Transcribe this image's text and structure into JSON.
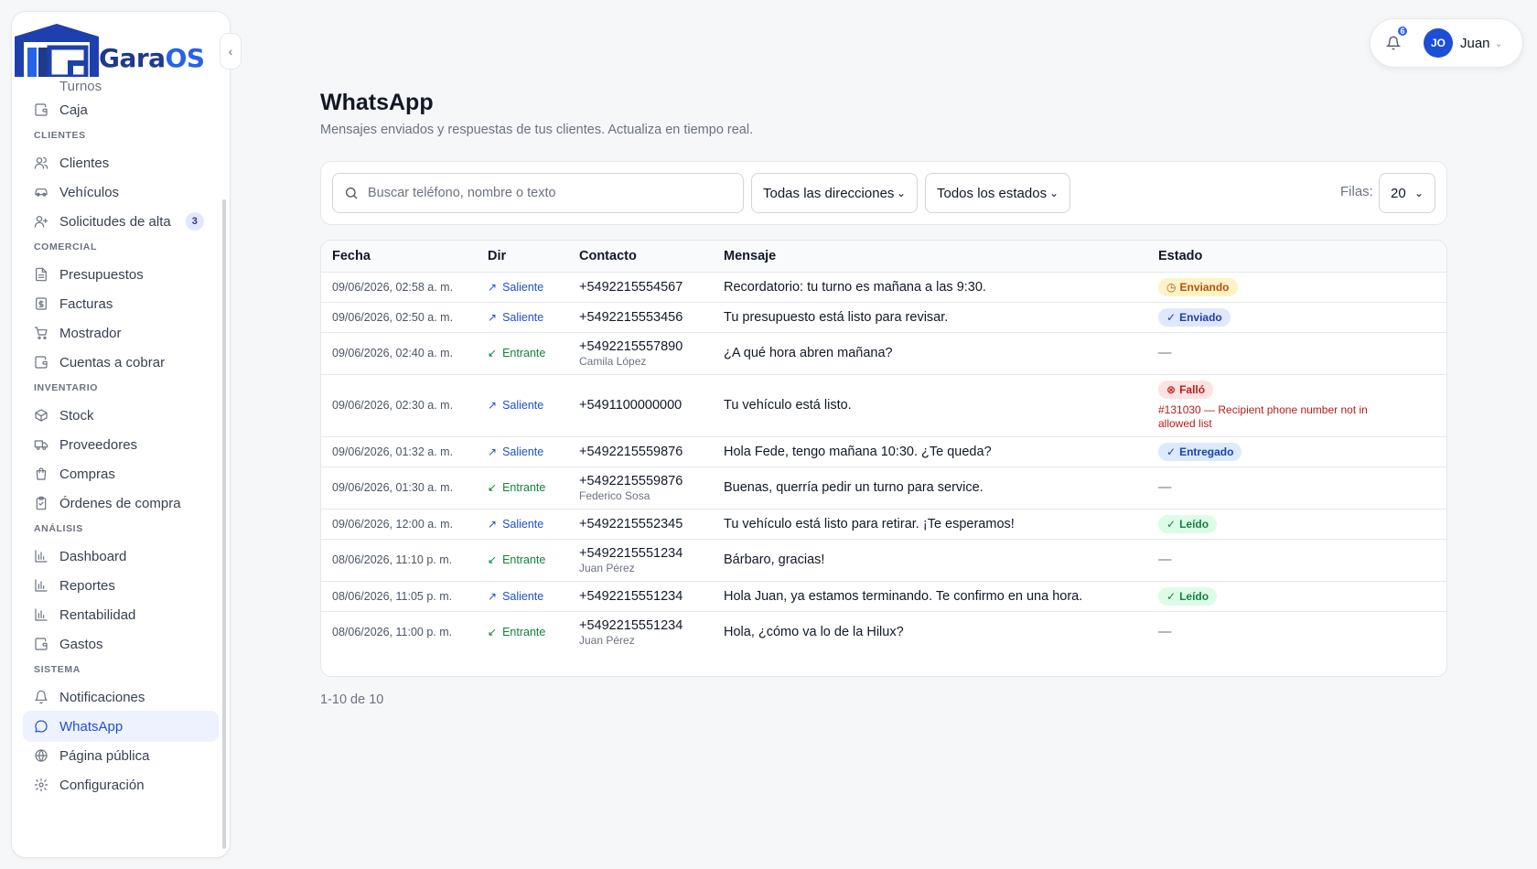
{
  "brand": {
    "name_part1": "Gara",
    "name_part2": "OS"
  },
  "sidebar": {
    "partial_item": "Turnos",
    "groups": [
      {
        "section": "",
        "items": [
          {
            "label": "Caja",
            "icon": "wallet-icon"
          }
        ]
      },
      {
        "section": "CLIENTES",
        "items": [
          {
            "label": "Clientes",
            "icon": "users-icon"
          },
          {
            "label": "Vehículos",
            "icon": "car-icon"
          },
          {
            "label": "Solicitudes de alta",
            "icon": "user-plus-icon",
            "badge": "3"
          }
        ]
      },
      {
        "section": "COMERCIAL",
        "items": [
          {
            "label": "Presupuestos",
            "icon": "file-text-icon"
          },
          {
            "label": "Facturas",
            "icon": "receipt-icon"
          },
          {
            "label": "Mostrador",
            "icon": "cart-icon"
          },
          {
            "label": "Cuentas a cobrar",
            "icon": "wallet-icon"
          }
        ]
      },
      {
        "section": "INVENTARIO",
        "items": [
          {
            "label": "Stock",
            "icon": "box-icon"
          },
          {
            "label": "Proveedores",
            "icon": "truck-icon"
          },
          {
            "label": "Compras",
            "icon": "bag-icon"
          },
          {
            "label": "Órdenes de compra",
            "icon": "clipboard-icon"
          }
        ]
      },
      {
        "section": "ANÁLISIS",
        "items": [
          {
            "label": "Dashboard",
            "icon": "bar-chart-icon"
          },
          {
            "label": "Reportes",
            "icon": "bar-chart-icon"
          },
          {
            "label": "Rentabilidad",
            "icon": "bar-chart-icon"
          },
          {
            "label": "Gastos",
            "icon": "wallet-icon"
          }
        ]
      },
      {
        "section": "SISTEMA",
        "items": [
          {
            "label": "Notificaciones",
            "icon": "bell-icon"
          },
          {
            "label": "WhatsApp",
            "icon": "message-circle-icon",
            "active": true
          },
          {
            "label": "Página pública",
            "icon": "globe-icon"
          },
          {
            "label": "Configuración",
            "icon": "gear-icon"
          }
        ]
      }
    ]
  },
  "header": {
    "notif_count": "6",
    "user_initials": "JO",
    "user_name": "Juan"
  },
  "page": {
    "title": "WhatsApp",
    "subtitle": "Mensajes enviados y respuestas de tus clientes. Actualiza en tiempo real."
  },
  "filters": {
    "search_placeholder": "Buscar teléfono, nombre o texto",
    "direction": "Todas las direcciones",
    "status": "Todos los estados",
    "rows_label": "Filas:",
    "rows_value": "20"
  },
  "table": {
    "headers": {
      "fecha": "Fecha",
      "dir": "Dir",
      "contacto": "Contacto",
      "mensaje": "Mensaje",
      "estado": "Estado"
    },
    "rows": [
      {
        "fecha": "09/06/2026, 02:58 a. m.",
        "dir": "Saliente",
        "dir_type": "out",
        "phone": "+5492215554567",
        "name": "",
        "mensaje": "Recordatorio: tu turno es mañana a las 9:30.",
        "estado": "Enviando",
        "estado_type": "enviando",
        "error": "",
        "height": 33
      },
      {
        "fecha": "09/06/2026, 02:50 a. m.",
        "dir": "Saliente",
        "dir_type": "out",
        "phone": "+5492215553456",
        "name": "",
        "mensaje": "Tu presupuesto está listo para revisar.",
        "estado": "Enviado",
        "estado_type": "enviado",
        "error": "",
        "height": 33
      },
      {
        "fecha": "09/06/2026, 02:40 a. m.",
        "dir": "Entrante",
        "dir_type": "in",
        "phone": "+5492215557890",
        "name": "Camila López",
        "mensaje": "¿A qué hora abren mañana?",
        "estado": "—",
        "estado_type": "none",
        "error": "",
        "height": 46
      },
      {
        "fecha": "09/06/2026, 02:30 a. m.",
        "dir": "Saliente",
        "dir_type": "out",
        "phone": "+5491100000000",
        "name": "",
        "mensaje": "Tu vehículo está listo.",
        "estado": "Falló",
        "estado_type": "fallo",
        "error": "#131030 — Recipient phone number not in allowed list",
        "height": 68
      },
      {
        "fecha": "09/06/2026, 01:32 a. m.",
        "dir": "Saliente",
        "dir_type": "out",
        "phone": "+5492215559876",
        "name": "",
        "mensaje": "Hola Fede, tengo mañana 10:30. ¿Te queda?",
        "estado": "Entregado",
        "estado_type": "entregado",
        "error": "",
        "height": 33
      },
      {
        "fecha": "09/06/2026, 01:30 a. m.",
        "dir": "Entrante",
        "dir_type": "in",
        "phone": "+5492215559876",
        "name": "Federico Sosa",
        "mensaje": "Buenas, querría pedir un turno para service.",
        "estado": "—",
        "estado_type": "none",
        "error": "",
        "height": 46
      },
      {
        "fecha": "09/06/2026, 12:00 a. m.",
        "dir": "Saliente",
        "dir_type": "out",
        "phone": "+5492215552345",
        "name": "",
        "mensaje": "Tu vehículo está listo para retirar. ¡Te esperamos!",
        "estado": "Leído",
        "estado_type": "leido",
        "error": "",
        "height": 33
      },
      {
        "fecha": "08/06/2026, 11:10 p. m.",
        "dir": "Entrante",
        "dir_type": "in",
        "phone": "+5492215551234",
        "name": "Juan Pérez",
        "mensaje": "Bárbaro, gracias!",
        "estado": "—",
        "estado_type": "none",
        "error": "",
        "height": 46
      },
      {
        "fecha": "08/06/2026, 11:05 p. m.",
        "dir": "Saliente",
        "dir_type": "out",
        "phone": "+5492215551234",
        "name": "",
        "mensaje": "Hola Juan, ya estamos terminando. Te confirmo en una hora.",
        "estado": "Leído",
        "estado_type": "leido",
        "error": "",
        "height": 33
      },
      {
        "fecha": "08/06/2026, 11:00 p. m.",
        "dir": "Entrante",
        "dir_type": "in",
        "phone": "+5492215551234",
        "name": "Juan Pérez",
        "mensaje": "Hola, ¿cómo va lo de la Hilux?",
        "estado": "—",
        "estado_type": "none",
        "error": "",
        "height": 46
      }
    ]
  },
  "pager": {
    "text": "1-10 de 10"
  },
  "colors": {
    "accent": "#2563eb",
    "brand_dark": "#1e3a8a"
  }
}
